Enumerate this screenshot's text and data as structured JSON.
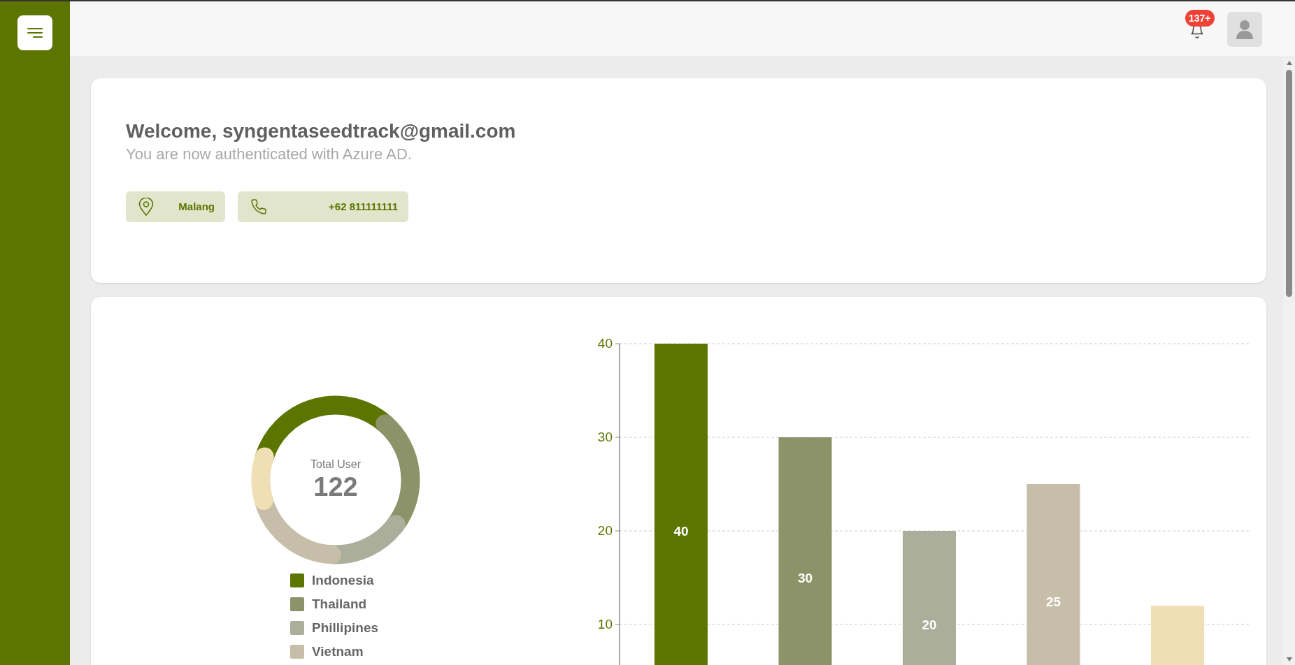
{
  "header": {
    "notification_badge": "137+"
  },
  "welcome_card": {
    "title": "Welcome, syngentaseedtrack@gmail.com",
    "subtitle": "You are now authenticated with Azure AD.",
    "chips": [
      {
        "kind": "location",
        "text": "Malang"
      },
      {
        "kind": "phone",
        "text": "+62 811111111"
      }
    ]
  },
  "users_card": {
    "donut": {
      "label": "Total User",
      "total": "122"
    },
    "legend": [
      {
        "label": "Indonesia",
        "color": "#5c7400"
      },
      {
        "label": "Thailand",
        "color": "#8c9368"
      },
      {
        "label": "Phillipines",
        "color": "#aaae9b"
      },
      {
        "label": "Vietnam",
        "color": "#c7bea9"
      }
    ],
    "bar_chart": {
      "chart_data": {
        "type": "bar",
        "ylim": [
          0,
          40
        ],
        "grid": true,
        "yticks": [
          10,
          20,
          30,
          40
        ],
        "value_labels": [
          "40",
          "30",
          "20",
          "25",
          null
        ],
        "values": [
          40,
          30,
          20,
          25,
          12
        ],
        "colors": [
          "#5c7400",
          "#8c9368",
          "#aaae9b",
          "#c7bea9",
          "#f0dfb4"
        ]
      }
    }
  }
}
